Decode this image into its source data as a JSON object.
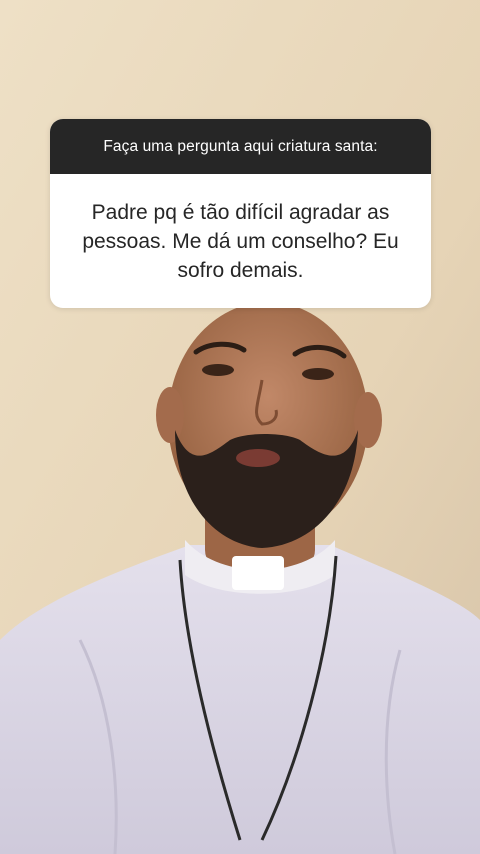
{
  "question_box": {
    "header": "Faça uma pergunta aqui criatura santa:",
    "question": "Padre pq é tão difícil agradar as pessoas. Me dá um conselho? Eu sofro demais."
  },
  "colors": {
    "header_bg": "#262626",
    "card_bg": "#ffffff",
    "wall": "#e8d7ba",
    "shirt": "#ddd9e6",
    "skin": "#b0785a"
  },
  "icons": {
    "background": "video-frame-person"
  }
}
